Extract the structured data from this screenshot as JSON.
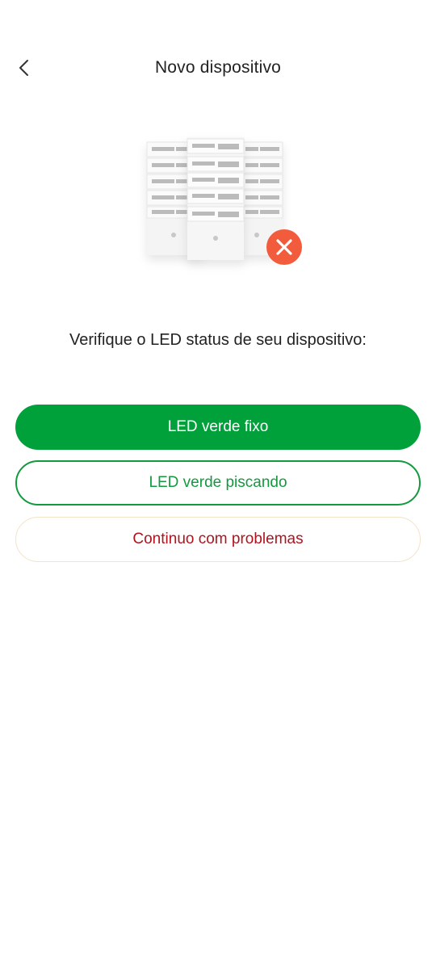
{
  "header": {
    "title": "Novo dispositivo",
    "back_icon": "chevron-left-icon"
  },
  "illustration": {
    "icon": "server-rack-icon",
    "status_icon": "error-x-icon",
    "status_color": "#f25c3c"
  },
  "main": {
    "instruction": "Verifique o LED status de seu dispositivo:"
  },
  "options": {
    "solid_label": "LED verde fixo",
    "blinking_label": "LED verde piscando",
    "problem_label": "Continuo com problemas"
  },
  "colors": {
    "primary_green": "#00a13a",
    "outline_green": "#139a3f",
    "problem_red": "#b3121d"
  }
}
